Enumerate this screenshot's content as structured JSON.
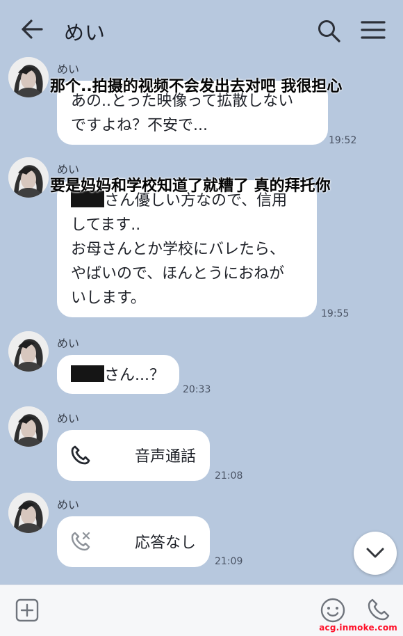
{
  "header": {
    "title": "めい",
    "back_icon": "arrow-left-icon",
    "search_icon": "search-icon",
    "menu_icon": "hamburger-menu-icon"
  },
  "messages": [
    {
      "sender": "めい",
      "caption": "那个..拍摄的视频不会发出去对吧 我很担心",
      "lines": [
        "あの..とった映像って拡散しない",
        "ですよね？不安で..."
      ],
      "time": "19:52"
    },
    {
      "sender": "めい",
      "caption": "要是妈妈和学校知道了就糟了 真的拜托你",
      "first_line_suffix": "さん優しい方なので、信用",
      "lines": [
        "してます..",
        "お母さんとか学校にバレたら、",
        "やばいので、ほんとうにおねが",
        "いします。"
      ],
      "time": "19:55"
    },
    {
      "sender": "めい",
      "text_suffix": "さん...？",
      "time": "20:33"
    },
    {
      "sender": "めい",
      "call_label": "音声通話",
      "call_icon": "phone-icon",
      "time": "21:08"
    },
    {
      "sender": "めい",
      "call_label": "応答なし",
      "call_icon": "missed-call-icon",
      "time": "21:09"
    }
  ],
  "composer": {
    "add_icon": "plus-square-icon",
    "emoji_icon": "smiley-icon",
    "call_icon": "phone-icon"
  },
  "scroll_icon": "chevron-down-icon",
  "watermark": "acg.inmoke.com",
  "colors": {
    "background": "#b7c8de",
    "bubble": "#ffffff",
    "watermark": "#ff0f28"
  }
}
